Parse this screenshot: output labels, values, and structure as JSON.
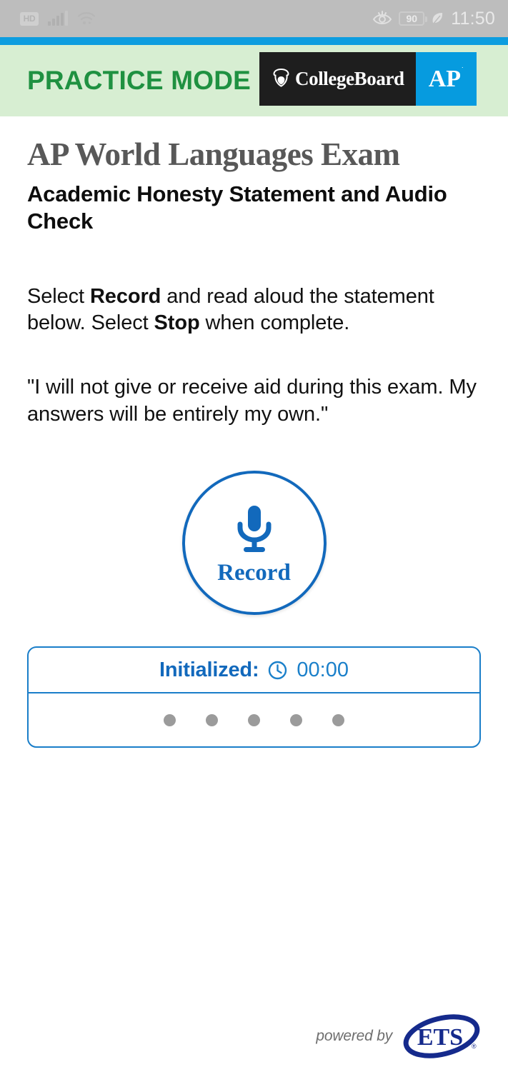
{
  "status_bar": {
    "hd_label": "HD",
    "signal_icon": "cellular-signal-icon",
    "wifi_icon": "wifi-icon",
    "eye_comfort_icon": "eye-comfort-icon",
    "battery_level": "90",
    "power_saving_icon": "leaf-power-saving-icon",
    "time": "11:50",
    "background_color": "#bdbdbd"
  },
  "accent_bar": {
    "color": "#0d9ddf"
  },
  "header": {
    "practice_mode_label": "PRACTICE MODE",
    "practice_mode_color": "#1f9141",
    "background_color": "#d7eed2",
    "collegeboard_logo_text": "CollegeBoard",
    "collegeboard_logo_background": "#1e1e1e",
    "acorn_icon": "acorn-icon",
    "ap_logo_text": "AP",
    "ap_logo_registered_mark": "˙",
    "ap_logo_background": "#069bdf"
  },
  "main": {
    "title": "AP World Languages Exam",
    "title_color": "#585858",
    "subtitle": "Academic Honesty Statement and Audio Check",
    "instruction_prefix": "Select ",
    "instruction_record": "Record",
    "instruction_middle": " and read aloud the statement below. Select ",
    "instruction_stop": "Stop",
    "instruction_suffix": " when complete.",
    "honesty_statement": "\"I will not give or receive aid during this exam. My answers will be entirely my own.\""
  },
  "record_button": {
    "label": "Record",
    "mic_icon": "microphone-icon",
    "accent_color": "#1269bc"
  },
  "status_panel": {
    "state_label": "Initialized:",
    "clock_icon": "clock-icon",
    "timer": "00:00",
    "border_color": "#1a7ec9",
    "meter_dot_count": 5,
    "meter_dot_color": "#9b9b9b"
  },
  "footer": {
    "powered_by_label": "powered by",
    "ets_logo_text": "ETS",
    "ets_logo_icon": "ets-logo",
    "ets_logo_color": "#152a8c",
    "ets_registered_mark": "®"
  }
}
